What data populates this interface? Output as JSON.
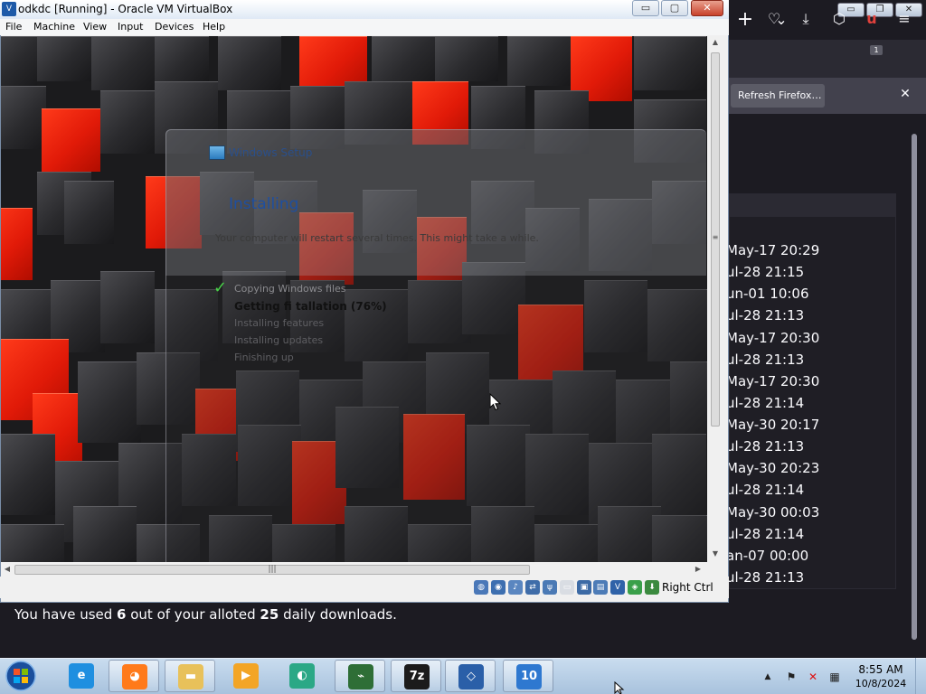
{
  "firefox": {
    "new_tab_glyph": "+",
    "tabs_menu_glyph": "⌄",
    "minimize_glyph": "▭",
    "restore_glyph": "❐",
    "close_glyph": "✕",
    "toolbar": {
      "pocket_glyph": "♡",
      "download_glyph": "⤓",
      "extensions_glyph": "⬡",
      "ublock_glyph": "u",
      "badge": "1",
      "menu_glyph": "≡"
    },
    "notification": {
      "button_label": "Refresh Firefox…",
      "close_glyph": "✕"
    },
    "dates": [
      "May-17 20:29",
      "ul-28 21:15",
      "un-01 10:06",
      "ul-28 21:13",
      "May-17 20:30",
      "ul-28 21:13",
      "May-17 20:30",
      "ul-28 21:14",
      "May-30 20:17",
      "ul-28 21:13",
      "May-30 20:23",
      "ul-28 21:14",
      "May-30 00:03",
      "ul-28 21:14",
      "an-07 00:00",
      "ul-28 21:13"
    ],
    "downloads_prefix": "You have used ",
    "downloads_used": "6",
    "downloads_middle": " out of your alloted ",
    "downloads_total": "25",
    "downloads_suffix": " daily downloads."
  },
  "virtualbox": {
    "title": "odkdc [Running] - Oracle VM VirtualBox",
    "app_icon_glyph": "V",
    "minimize_glyph": "▭",
    "maximize_glyph": "▢",
    "close_glyph": "✕",
    "menu": [
      "File",
      "Machine",
      "View",
      "Input",
      "Devices",
      "Help"
    ],
    "host_key": "Right Ctrl",
    "hscroll_grip": "|||",
    "status_icons": [
      {
        "name": "hard-disk-icon",
        "glyph": "◍",
        "color": "#4a78b8"
      },
      {
        "name": "optical-drive-icon",
        "glyph": "◉",
        "color": "#3d6fb0"
      },
      {
        "name": "audio-icon",
        "glyph": "♪",
        "color": "#5a86c0"
      },
      {
        "name": "network-icon",
        "glyph": "⇄",
        "color": "#3f6da9"
      },
      {
        "name": "usb-icon",
        "glyph": "ψ",
        "color": "#4b7ab5"
      },
      {
        "name": "shared-folders-icon",
        "glyph": "▭",
        "color": "#d9dde3"
      },
      {
        "name": "display-icon",
        "glyph": "▣",
        "color": "#3c6aa5"
      },
      {
        "name": "video-capture-icon",
        "glyph": "▤",
        "color": "#4d7cb7"
      },
      {
        "name": "guest-additions-icon",
        "glyph": "V",
        "color": "#2f62a8"
      },
      {
        "name": "cpu-icon",
        "glyph": "◈",
        "color": "#3aa04a"
      },
      {
        "name": "mouse-integration-icon",
        "glyph": "⬇",
        "color": "#3b8a3f"
      }
    ]
  },
  "setup": {
    "title": "Windows Setup",
    "heading": "Installing",
    "subtitle": "Your computer will restart several times. This might take a while.",
    "check_glyph": "✓",
    "steps": [
      "Copying Windows files",
      "Getting fi              tallation (76%)",
      "Installing features",
      "Installing updates",
      "Finishing up"
    ]
  },
  "taskbar": {
    "apps": [
      {
        "name": "internet-explorer-icon",
        "glyph": "e",
        "color": "#1f8fe0",
        "open": false
      },
      {
        "name": "firefox-icon",
        "glyph": "◕",
        "color": "#ff7a1a",
        "open": true
      },
      {
        "name": "file-explorer-icon",
        "glyph": "▬",
        "color": "#e8c15a",
        "open": true
      },
      {
        "name": "media-player-icon",
        "glyph": "▶",
        "color": "#f3a526",
        "open": false
      },
      {
        "name": "zoom-app-icon",
        "glyph": "◐",
        "color": "#2ba886",
        "open": false
      },
      {
        "name": "task-manager-icon",
        "glyph": "⌁",
        "color": "#2e6e36",
        "open": true
      },
      {
        "name": "seven-zip-icon",
        "glyph": "7z",
        "color": "#1b1b1b",
        "open": true
      },
      {
        "name": "virtualbox-icon",
        "glyph": "◇",
        "color": "#2a5fa8",
        "open": true
      },
      {
        "name": "windows-10-iso-icon",
        "glyph": "10",
        "color": "#2e78d0",
        "open": true
      }
    ],
    "tray_up_glyph": "▲",
    "tray": [
      {
        "name": "action-center-icon",
        "glyph": "⚑"
      },
      {
        "name": "volume-muted-icon",
        "glyph": "✕"
      },
      {
        "name": "network-tray-icon",
        "glyph": "▦"
      }
    ],
    "time": "8:55 AM",
    "date": "10/8/2024"
  },
  "colors": {
    "firefox_bg": "#1c1b22",
    "firefox_toolbar": "#2b2a33",
    "accent_red": "#e11a08",
    "taskbar": "#b9d0e8"
  }
}
